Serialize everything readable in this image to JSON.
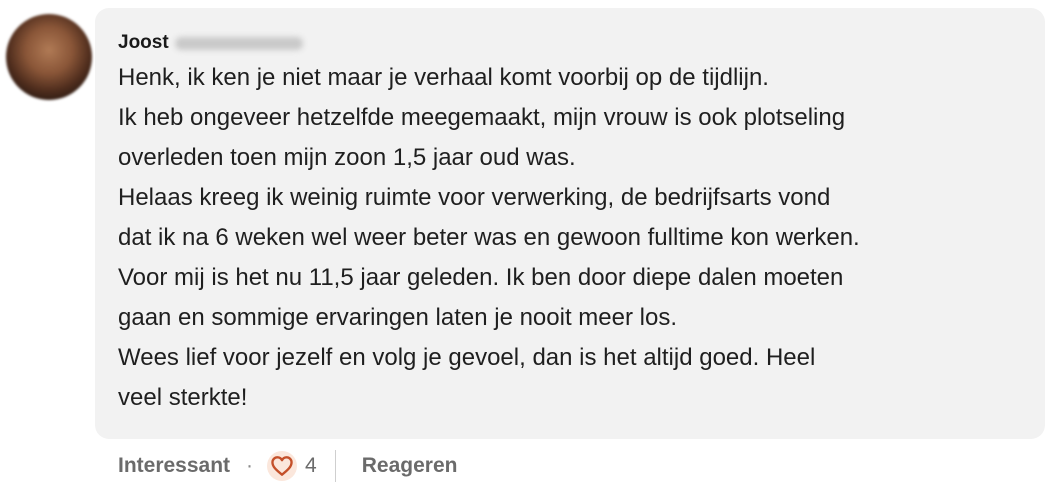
{
  "comment": {
    "author_first_name": "Joost",
    "lines": [
      "Henk, ik ken je niet maar je verhaal komt voorbij op de tijdlijn.",
      "Ik heb ongeveer hetzelfde meegemaakt, mijn vrouw is ook plotseling",
      "overleden toen mijn zoon 1,5 jaar oud was.",
      "Helaas kreeg ik weinig ruimte voor verwerking, de bedrijfsarts vond",
      "dat ik na 6 weken wel weer beter was en gewoon fulltime kon werken.",
      "Voor mij is het nu 11,5 jaar geleden. Ik ben door diepe dalen moeten",
      "gaan en sommige ervaringen laten je nooit meer los.",
      "Wees lief voor jezelf en volg je gevoel, dan is het altijd goed. Heel",
      "veel sterkte!"
    ]
  },
  "actions": {
    "interesting_label": "Interessant",
    "separator": "·",
    "reaction_count": "4",
    "reply_label": "Reageren"
  },
  "icons": {
    "reaction": "heart-icon",
    "reaction_color": "#c4502a",
    "reaction_bg": "#fbe7dc"
  },
  "colors": {
    "bubble_bg": "#f2f2f2",
    "text": "#1f1f1f",
    "muted": "#6b6b6b"
  }
}
